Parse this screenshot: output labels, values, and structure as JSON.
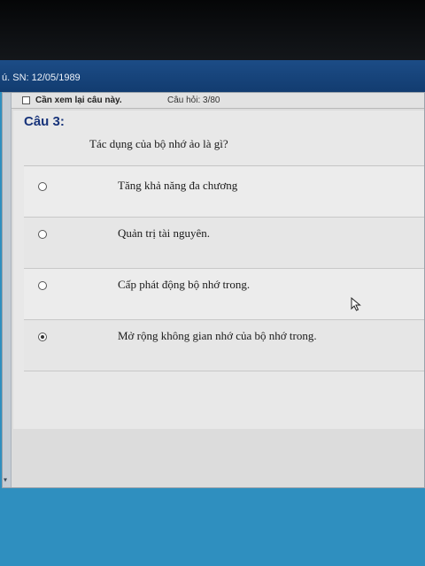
{
  "title_bar": {
    "text": "ú. SN: 12/05/1989"
  },
  "toolbar": {
    "review_label": "Cần xem lại câu này.",
    "counter": "Câu hỏi: 3/80"
  },
  "question": {
    "number": "Câu 3:",
    "text": "Tác dụng của bộ nhớ ảo là gì?"
  },
  "answers": [
    {
      "label": "Tăng khả năng đa chương",
      "selected": false
    },
    {
      "label": "Quản trị tài nguyên.",
      "selected": false
    },
    {
      "label": "Cấp phát động bộ nhớ trong.",
      "selected": false
    },
    {
      "label": "Mở rộng không gian nhớ của bộ nhớ trong.",
      "selected": true
    }
  ],
  "icons": {
    "cursor": "mouse-pointer-icon",
    "checkbox": "checkbox-icon",
    "radio": "radio-icon",
    "scroll": "chevron-down-icon"
  },
  "colors": {
    "title_bar": "#1c4c86",
    "question_number": "#17337a",
    "desktop": "#2f8fbf"
  }
}
